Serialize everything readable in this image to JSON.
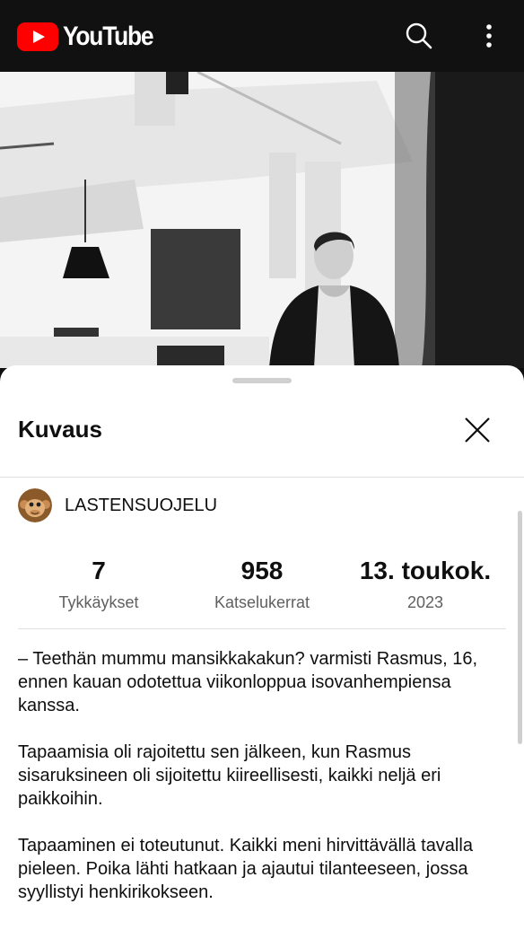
{
  "appbar": {
    "logo_text": "YouTube",
    "search_icon": "search-icon",
    "more_icon": "more-vert-icon",
    "brand_color": "#ff0000"
  },
  "sheet": {
    "title": "Kuvaus",
    "close_icon": "close-icon"
  },
  "channel": {
    "name": "LASTENSUOJELU",
    "avatar_icon": "monkey-avatar"
  },
  "stats": [
    {
      "value": "7",
      "label": "Tykkäykset"
    },
    {
      "value": "958",
      "label": "Katselukerrat"
    },
    {
      "value": "13. toukok.",
      "label": "2023"
    }
  ],
  "description": [
    "– Teethän mummu mansikkakakun? varmisti Rasmus, 16, ennen kauan odotettua viikonloppua isovanhempiensa kanssa.",
    "Tapaamisia oli rajoitettu sen jälkeen, kun Rasmus sisaruksineen oli sijoitettu kiireellisesti, kaikki neljä eri paikkoihin.",
    "Tapaaminen ei toteutunut. Kaikki meni hirvittävällä tavalla pieleen. Poika lähti hatkaan ja ajautui tilanteeseen, jossa syyllistyi henkirikokseen."
  ]
}
